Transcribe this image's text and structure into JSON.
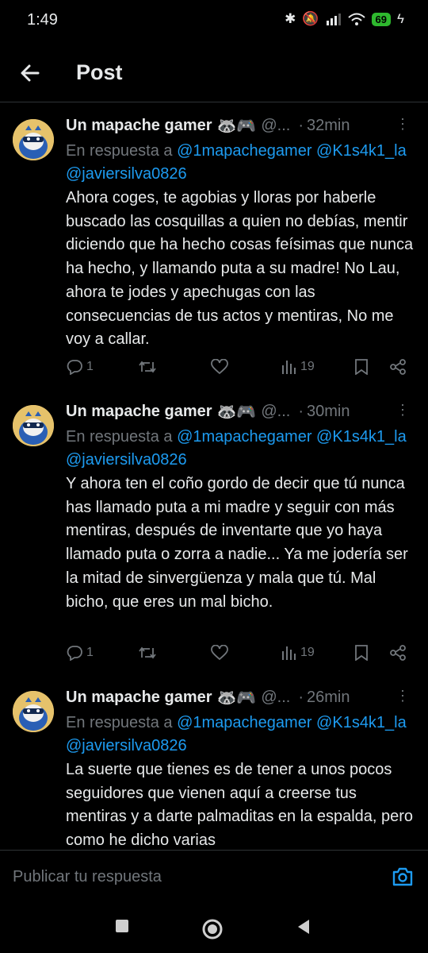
{
  "status": {
    "time": "1:49",
    "battery": "69"
  },
  "header": {
    "title": "Post"
  },
  "tweets": [
    {
      "name": "Un mapache gamer",
      "emoji": "🦝🎮",
      "handle": "@...",
      "time_ago": "32min",
      "reply_prefix": "En respuesta a",
      "mentions": [
        "@1mapachegamer",
        "@K1s4k1_la",
        "@javiersilva0826"
      ],
      "text": "Ahora coges, te agobias y lloras por haberle buscado las cosquillas a quien no debías, mentir diciendo que ha hecho cosas feísimas que nunca ha hecho, y llamando puta a su madre! No Lau, ahora te jodes y apechugas con las consecuencias de tus actos y mentiras, No me voy a callar.",
      "replies": "1",
      "views": "19"
    },
    {
      "name": "Un mapache gamer",
      "emoji": "🦝🎮",
      "handle": "@...",
      "time_ago": "30min",
      "reply_prefix": "En respuesta a",
      "mentions": [
        "@1mapachegamer",
        "@K1s4k1_la",
        "@javiersilva0826"
      ],
      "text": "Y ahora ten el coño gordo de decir que tú nunca has llamado puta a mi madre y seguir con más mentiras, después de inventarte que yo haya llamado puta o zorra a nadie... Ya me jodería ser la mitad de sinvergüenza y mala que tú. Mal bicho, que eres un mal bicho.",
      "replies": "1",
      "views": "19"
    },
    {
      "name": "Un mapache gamer",
      "emoji": "🦝🎮",
      "handle": "@...",
      "time_ago": "26min",
      "reply_prefix": "En respuesta a",
      "mentions": [
        "@1mapachegamer",
        "@K1s4k1_la",
        "@javiersilva0826"
      ],
      "text": "La suerte que tienes es de tener a unos pocos seguidores que vienen aquí a creerse tus mentiras y a darte palmaditas en la espalda, pero como he dicho varias"
    }
  ],
  "compose": {
    "placeholder": "Publicar tu respuesta"
  },
  "icons": {
    "back": "arrow-left-icon",
    "more": "more-dots-icon",
    "reply": "reply-icon",
    "retweet": "retweet-icon",
    "like": "heart-icon",
    "views": "views-icon",
    "bookmark": "bookmark-icon",
    "share": "share-icon",
    "camera": "camera-icon"
  },
  "colors": {
    "background": "#000000",
    "accent": "#1d9bf0",
    "muted": "#71767b",
    "text": "#e7e9ea"
  }
}
